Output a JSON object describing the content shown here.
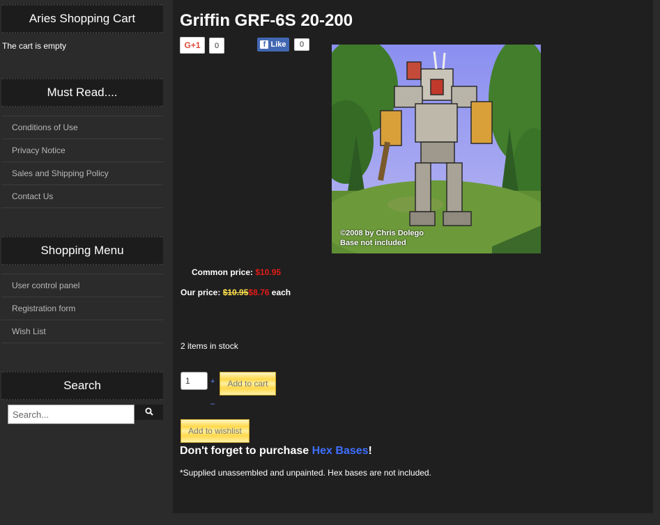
{
  "sidebar": {
    "cart": {
      "title": "Aries Shopping Cart",
      "status": "The cart is empty"
    },
    "must_read": {
      "title": "Must Read....",
      "items": [
        "Conditions of Use",
        "Privacy Notice",
        "Sales and Shipping Policy",
        "Contact Us"
      ]
    },
    "shopping_menu": {
      "title": "Shopping Menu",
      "items": [
        "User control panel",
        "Registration form",
        "Wish List"
      ]
    },
    "search": {
      "title": "Search",
      "placeholder": "Search...",
      "button_icon": "search-icon"
    }
  },
  "product": {
    "title": "Griffin GRF-6S 20-200",
    "social": {
      "gplus_label": "G+1",
      "gplus_count": "0",
      "fb_label": "Like",
      "fb_count": "0"
    },
    "image_caption_line1": "©2008 by Chris Dolego",
    "image_caption_line2": "Base not included",
    "common_price_label": "Common price:",
    "common_price": "$10.95",
    "our_price_label": "Our price:",
    "our_price_old": "$10.95",
    "our_price_new": "$8.76",
    "our_price_suffix": "each",
    "stock": "2 items in stock",
    "quantity": "1",
    "qty_plus": "+",
    "qty_minus": "–",
    "add_to_cart": "Add to cart",
    "add_to_wishlist": "Add to wishlist",
    "reminder_prefix": "Don't forget to purchase ",
    "reminder_link": "Hex Bases",
    "reminder_suffix": "!",
    "note": "*Supplied unassembled and unpainted. Hex bases are not included."
  },
  "colors": {
    "price_red": "#e41b17",
    "link_blue": "#3f6fff",
    "button_yellow": "#ffd84a"
  }
}
